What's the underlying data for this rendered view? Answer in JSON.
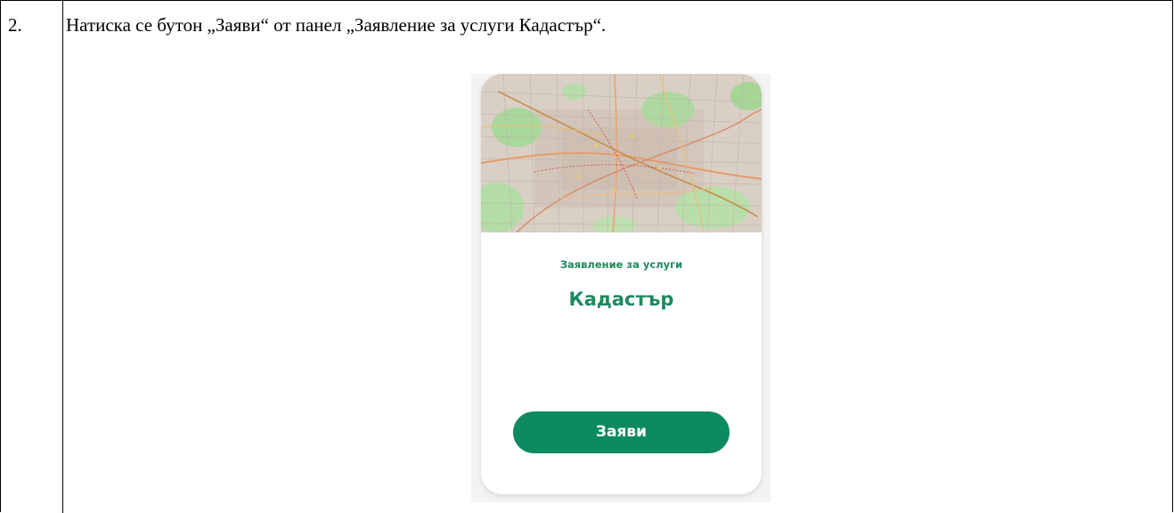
{
  "row": {
    "number": "2.",
    "instruction": "Натиска се бутон „Заяви“ от панел „Заявление за услуги Кадастър“."
  },
  "card": {
    "subtitle": "Заявление за услуги",
    "title": "Кадастър",
    "button_label": "Заяви",
    "accent_color": "#1e8a5c",
    "button_color": "#0d8a5e",
    "image": "city-map-thumbnail"
  }
}
